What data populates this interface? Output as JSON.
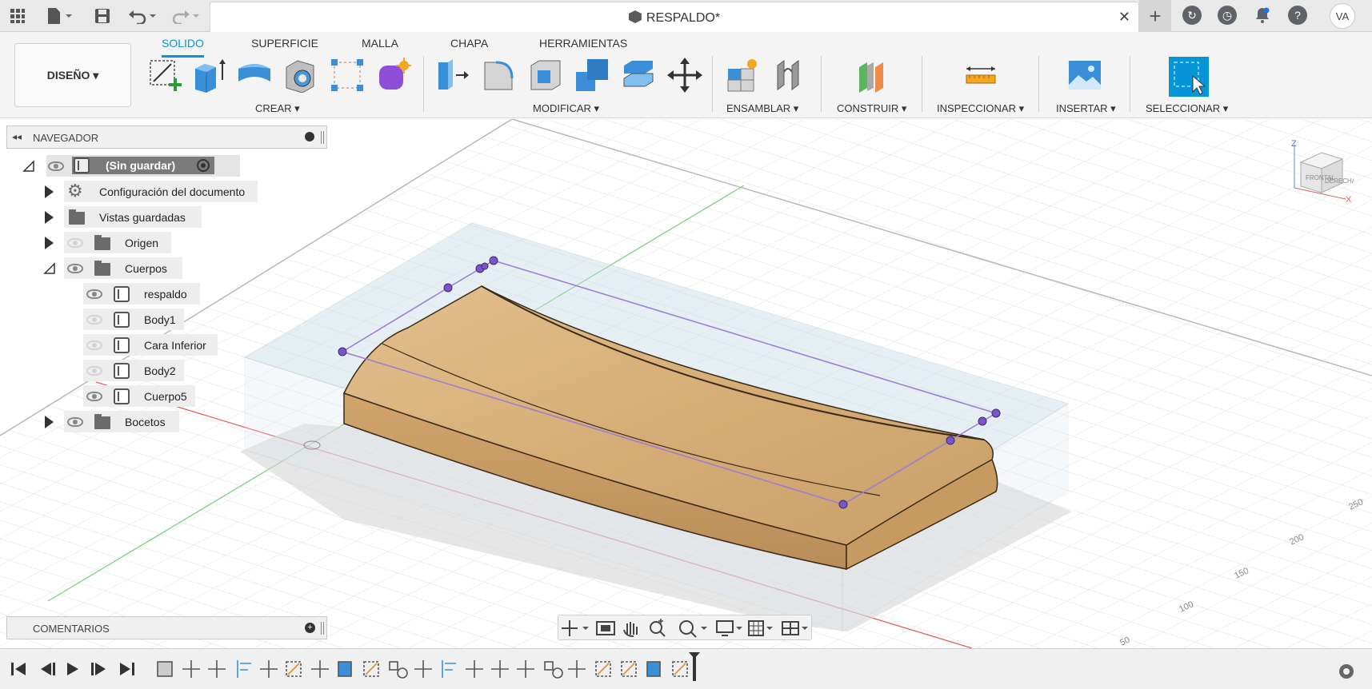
{
  "document": {
    "title": "RESPALDO*"
  },
  "user": {
    "initials": "VA"
  },
  "workspace": {
    "label": "DISEÑO ▾"
  },
  "tabs": [
    {
      "label": "SOLIDO",
      "active": true
    },
    {
      "label": "SUPERFICIE",
      "active": false
    },
    {
      "label": "MALLA",
      "active": false
    },
    {
      "label": "CHAPA",
      "active": false
    },
    {
      "label": "HERRAMIENTAS",
      "active": false
    }
  ],
  "groups": {
    "create": "CREAR ▾",
    "modify": "MODIFICAR ▾",
    "assemble": "ENSAMBLAR ▾",
    "construct": "CONSTRUIR ▾",
    "inspect": "INSPECCIONAR ▾",
    "insert": "INSERTAR ▾",
    "select": "SELECCIONAR ▾"
  },
  "browser": {
    "title": "NAVEGADOR",
    "root": "(Sin guardar)",
    "items": {
      "doc_settings": "Configuración del documento",
      "saved_views": "Vistas guardadas",
      "origin": "Origen",
      "bodies": "Cuerpos",
      "sketches": "Bocetos"
    },
    "bodies": [
      "respaldo",
      "Body1",
      "Cara Inferior",
      "Body2",
      "Cuerpo5"
    ]
  },
  "comments": {
    "title": "COMENTARIOS"
  },
  "viewcube": {
    "faces": [
      "FRONTAL",
      "DERECHA"
    ],
    "axes": [
      "Z",
      "X"
    ]
  },
  "grid_labels": [
    "250",
    "200",
    "150",
    "100",
    "50"
  ],
  "colors": {
    "accent": "#0696d7",
    "wood_top": "#d9b27c",
    "wood_side": "#c69a60",
    "sketch": "#9b7fd6",
    "axis_red": "#e06060",
    "axis_green": "#7ed07e"
  }
}
